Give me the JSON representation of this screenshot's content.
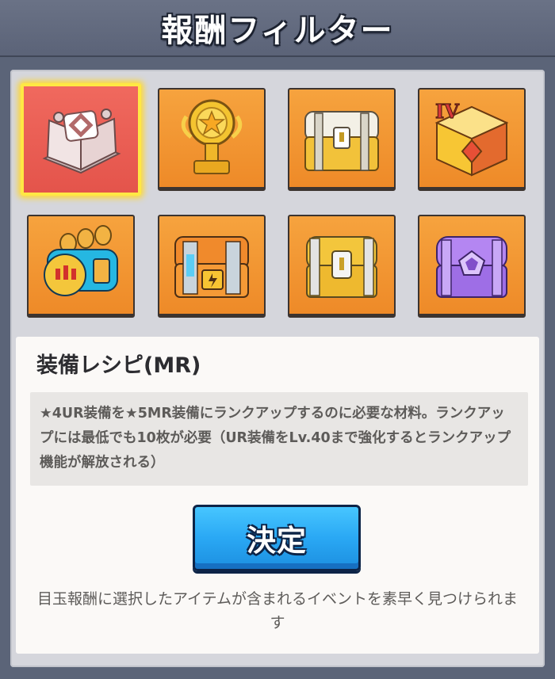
{
  "header": {
    "title": "報酬フィルター"
  },
  "tiles": [
    {
      "name": "equipment-recipe-mr",
      "icon": "recipe-book-icon",
      "selected": true
    },
    {
      "name": "trophy",
      "icon": "trophy-icon",
      "selected": false
    },
    {
      "name": "gold-chest",
      "icon": "gold-chest-icon",
      "selected": false
    },
    {
      "name": "rank-iv-crate",
      "icon": "rank-iv-crate-icon",
      "selected": false
    },
    {
      "name": "ammo-box",
      "icon": "ammo-box-icon",
      "selected": false
    },
    {
      "name": "tech-chest",
      "icon": "tech-chest-icon",
      "selected": false
    },
    {
      "name": "silver-gold-chest",
      "icon": "silver-gold-chest-icon",
      "selected": false
    },
    {
      "name": "purple-chest",
      "icon": "purple-chest-icon",
      "selected": false
    }
  ],
  "detail": {
    "title": "装備レシピ(MR)",
    "description": "★4UR装備を★5MR装備にランクアップするのに必要な材料。ランクアップには最低でも10枚が必要（UR装備をLv.40まで強化するとランクアップ機能が解放される）",
    "button_label": "決定",
    "hint": "目玉報酬に選択したアイテムが含まれるイベントを素早く見つけられます"
  },
  "colors": {
    "tile_orange": "#f39a35",
    "selected_tile": "#ea5d53",
    "selected_border": "#ffe844",
    "button_blue": "#2aa8f4"
  }
}
